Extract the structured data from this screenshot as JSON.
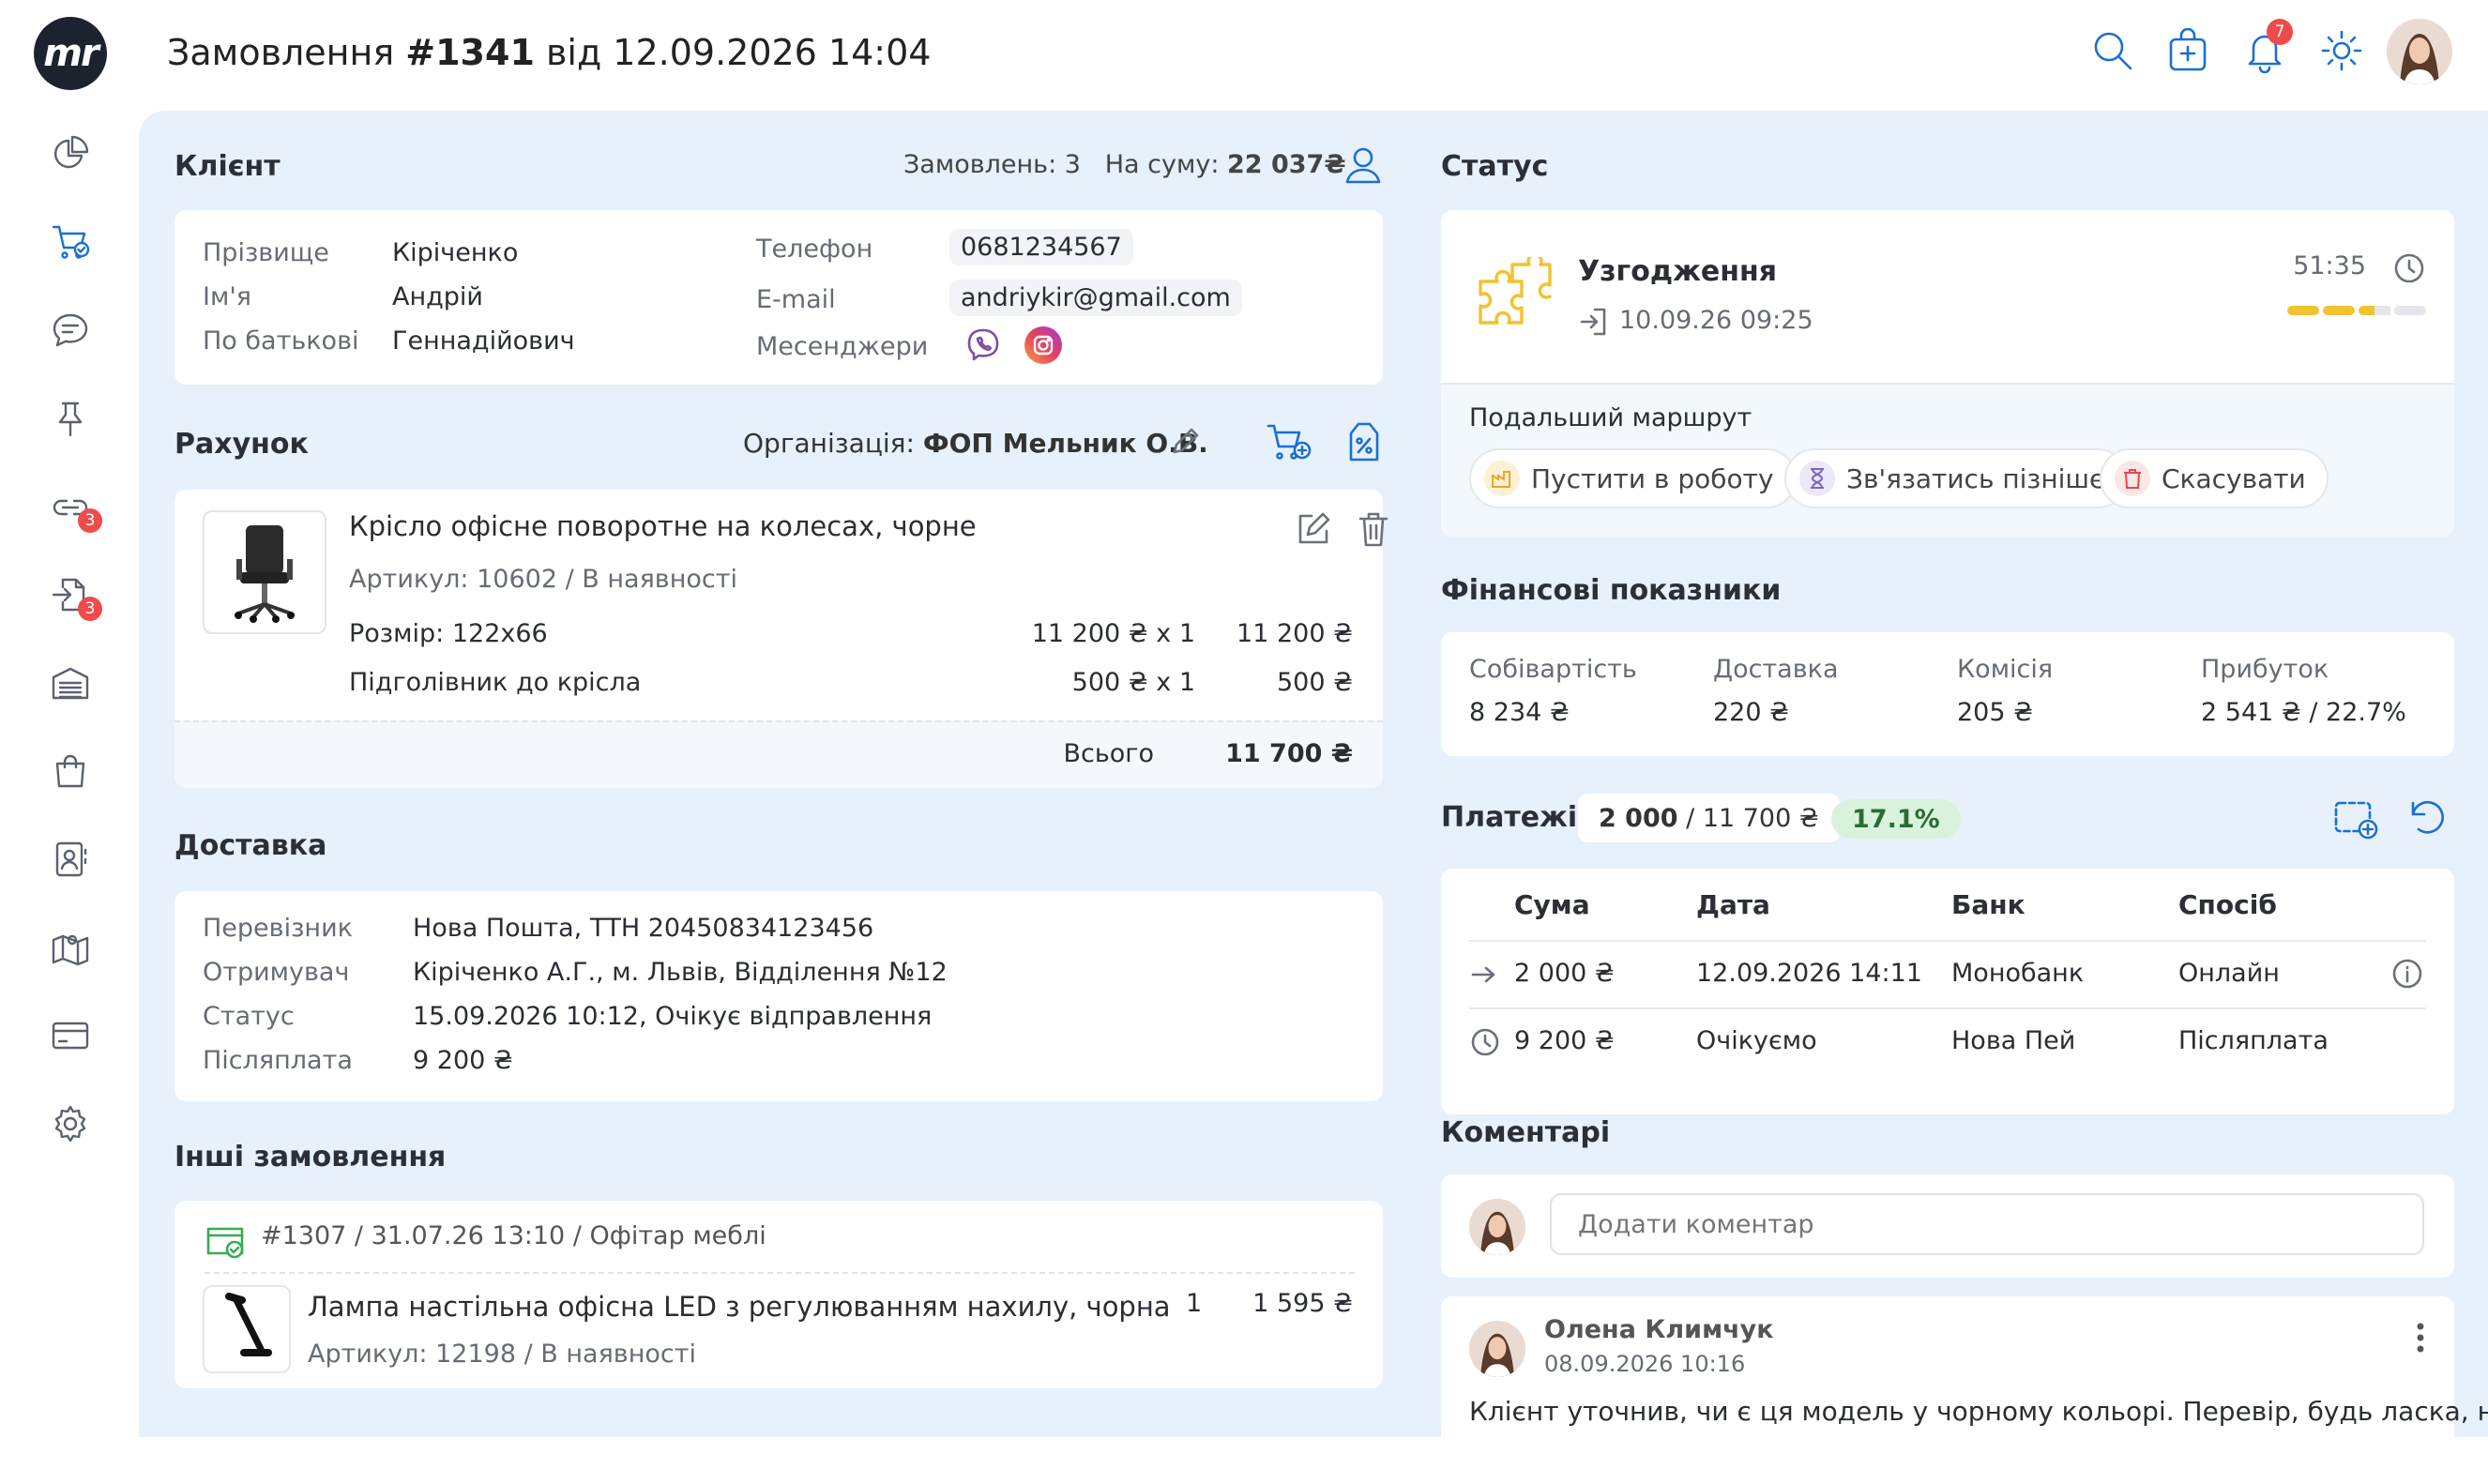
{
  "header": {
    "title_prefix": "Замовлення",
    "order_no": "#1341",
    "title_suffix": "від 12.09.2026 14:04",
    "notifications_count": "7"
  },
  "logo": {
    "text": "mr"
  },
  "sidebar": {
    "badges": {
      "links": "3",
      "returns": "3"
    }
  },
  "client": {
    "section_title": "Клієнт",
    "orders_label": "Замовлень:",
    "orders_count": "3",
    "sum_label": "На суму:",
    "sum_value": "22 037₴",
    "surname_label": "Прізвище",
    "surname": "Кіріченко",
    "name_label": "Ім'я",
    "name": "Андрій",
    "patronymic_label": "По батькові",
    "patronymic": "Геннадійович",
    "phone_label": "Телефон",
    "phone": "0681234567",
    "email_label": "E-mail",
    "email": "andriykir@gmail.com",
    "messengers_label": "Месенджери"
  },
  "invoice": {
    "section_title": "Рахунок",
    "org_label": "Організація:",
    "org_value": "ФОП Мельник О.В.",
    "product_name": "Крісло офісне поворотне на колесах,  чорне",
    "product_meta": "Артикул: 10602  /  В наявності",
    "lines": [
      {
        "name": "Розмір: 122х66",
        "price": "11 200 ₴ x 1",
        "total": "11 200 ₴"
      },
      {
        "name": "Підголівник до крісла",
        "price": "500 ₴  x  1",
        "total": "500 ₴"
      }
    ],
    "total_label": "Всього",
    "total_value": "11 700 ₴"
  },
  "delivery": {
    "section_title": "Доставка",
    "rows": [
      {
        "label": "Перевізник",
        "value": "Нова Пошта, ТТН 20450834123456"
      },
      {
        "label": "Отримувач",
        "value": "Кіріченко А.Г., м. Львів, Відділення №12"
      },
      {
        "label": "Статус",
        "value": "15.09.2026 10:12, Очікує відправлення"
      },
      {
        "label": "Післяплата",
        "value": "9 200 ₴"
      }
    ]
  },
  "other_orders": {
    "section_title": "Інші замовлення",
    "order_head": "#1307  /  31.07.26 13:10  /  Офітар меблі",
    "item_name": "Лампа настільна офісна LED з регулюванням нахилу, чорна",
    "item_meta": "Артикул: 12198  /  В наявності",
    "item_qty": "1",
    "item_sum": "1 595 ₴"
  },
  "status": {
    "section_title": "Статус",
    "state": "Узгодження",
    "since": "10.09.26 09:25",
    "timer": "51:35",
    "route_label": "Подальший маршрут",
    "actions": [
      "Пустити в роботу",
      "Зв'язатись пізніше",
      "Скасувати"
    ]
  },
  "finance": {
    "section_title": "Фінансові показники",
    "items": [
      {
        "label": "Собівартість",
        "value": "8 234 ₴"
      },
      {
        "label": "Доставка",
        "value": "220 ₴"
      },
      {
        "label": "Комісія",
        "value": "205 ₴"
      },
      {
        "label": "Прибуток",
        "value": "2 541 ₴ / 22.7%"
      }
    ]
  },
  "payments": {
    "section_title": "Платежі",
    "paid": "2 000",
    "total": "/ 11 700 ₴",
    "percent": "17.1%",
    "columns": [
      "Сума",
      "Дата",
      "Банк",
      "Спосіб"
    ],
    "rows": [
      {
        "sum": "2 000 ₴",
        "date": "12.09.2026 14:11",
        "bank": "Монобанк",
        "method": "Онлайн"
      },
      {
        "sum": "9 200 ₴",
        "date": "Очікуємо",
        "bank": "Нова Пей",
        "method": "Післяплата"
      }
    ]
  },
  "comments": {
    "section_title": "Коментарі",
    "placeholder": "Додати коментар",
    "author": "Олена Климчук",
    "date": "08.09.2026 10:16",
    "text": "Клієнт уточнив, чи є ця модель у чорному кольорі. Перевір, будь ласка, на"
  },
  "colors": {
    "accent": "#1b6fd0",
    "background": "#e6f1fb",
    "badge": "#ef4b4b",
    "status_icon": "#f2c230",
    "percent_bg": "#d9f2dc"
  }
}
